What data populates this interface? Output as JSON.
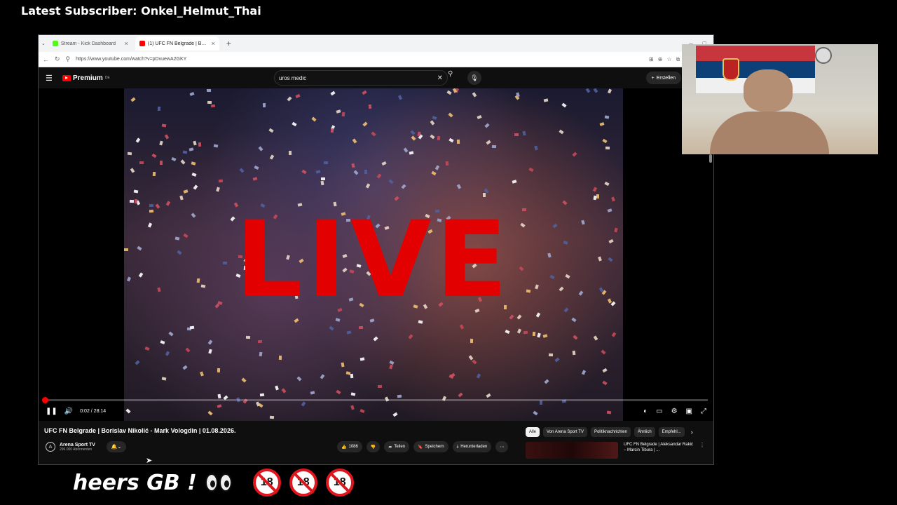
{
  "overlay": {
    "latest_subscriber": "Latest Subscriber: Onkel_Helmut_Thai"
  },
  "browser": {
    "tabs": [
      {
        "label": "Stream - Kick Dashboard",
        "icon": "kick-icon",
        "color": "#53fc18"
      },
      {
        "label": "(1) UFC FN Belgrade | Borisla...",
        "icon": "youtube-icon",
        "color": "#ff0000"
      }
    ],
    "new_tab": "+",
    "url": "https://www.youtube.com/watch?v=pDvuewA2GKY"
  },
  "youtube": {
    "logo_text": "Premium",
    "logo_region": "DE",
    "search_value": "uros medic",
    "create_label": "Erstellen",
    "notification_count": "1"
  },
  "player": {
    "overlay_text": "LIVE",
    "time": "0:02 / 28:14",
    "progress": 0.001
  },
  "video": {
    "title": "UFC FN Belgrade | Borislav Nikolić - Mark Vologdin | 01.08.2026.",
    "channel_name": "Arena Sport TV",
    "channel_subs": "296.000 Abonnenten",
    "likes": "1086",
    "share_label": "Teilen",
    "save_label": "Speichern",
    "download_label": "Herunterladen"
  },
  "chips": [
    "Alle",
    "Von Arena Sport TV",
    "Politiknachrichten",
    "Ähnlich",
    "Empfehl..."
  ],
  "recommendation": {
    "title": "UFC FN Belgrade | Aleksandar Rakić – Marcin Tibura | ..."
  },
  "ticker": {
    "text": "heers GB !"
  },
  "colors": {
    "live_red": "#e30000",
    "yt_bg": "#0f0f0f",
    "accent": "#ff0000"
  }
}
